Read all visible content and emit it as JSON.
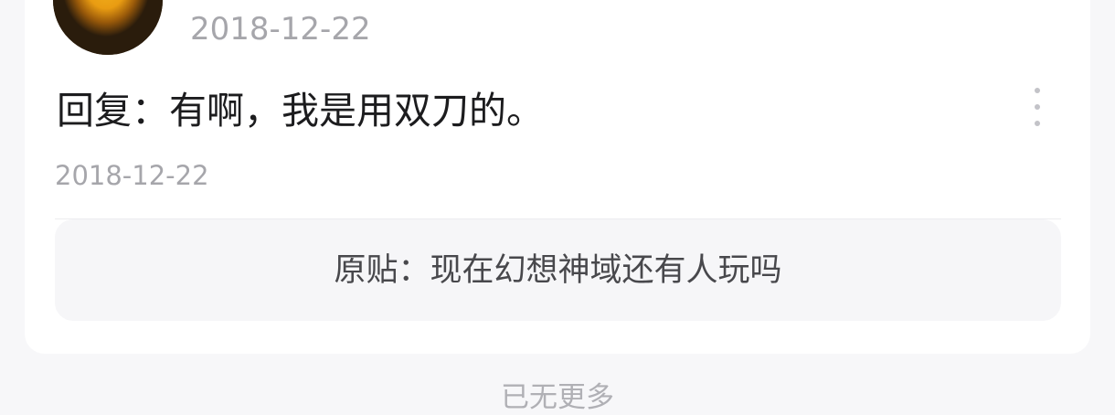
{
  "post": {
    "header_date": "2018-12-22",
    "reply_text": "回复：有啊，我是用双刀的。",
    "reply_date": "2018-12-22",
    "original_post": "原贴：现在幻想神域还有人玩吗",
    "more_icon": "more-vertical-icon"
  },
  "footer": {
    "end_text": "已无更多"
  },
  "colors": {
    "background": "#f7f7f9",
    "card": "#ffffff",
    "text_primary": "#1c1c1e",
    "text_secondary": "#a6a6ab",
    "quote_bg": "#f6f6f8"
  }
}
